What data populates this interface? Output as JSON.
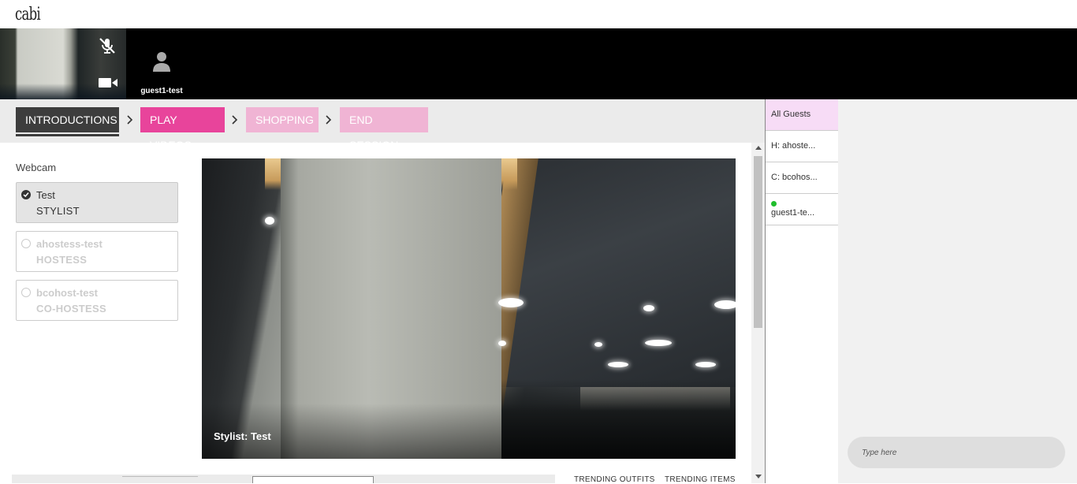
{
  "app": {
    "logo": "cabi"
  },
  "video_strip": {
    "self_tile": {
      "mic_icon": "mic-muted-icon",
      "camera_icon": "video-camera-icon"
    },
    "guest_tile": {
      "name": "guest1-test",
      "icon": "user-avatar-icon"
    }
  },
  "steps": [
    {
      "label": "INTRODUCTIONS",
      "state": "active"
    },
    {
      "label": "PLAY VIDEOS",
      "state": "next"
    },
    {
      "label": "SHOPPING",
      "state": "disabled"
    },
    {
      "label": "END SESSION",
      "state": "disabled"
    }
  ],
  "webcam": {
    "label": "Webcam",
    "participants": [
      {
        "name": "Test",
        "role": "STYLIST",
        "selected": true
      },
      {
        "name": "ahostess-test",
        "role": "HOSTESS",
        "selected": false
      },
      {
        "name": "bcohost-test",
        "role": "CO-HOSTESS",
        "selected": false
      }
    ]
  },
  "stage": {
    "caption": "Stylist: Test"
  },
  "trending": {
    "outfits": "TRENDING OUTFITS",
    "items": "TRENDING ITEMS"
  },
  "guest_list": [
    {
      "label": "All Guests",
      "selected": true
    },
    {
      "label": "H: ahoste..."
    },
    {
      "label": "C: bcohos..."
    },
    {
      "label": "guest1-te...",
      "online": true
    }
  ],
  "chat": {
    "placeholder": "Type here"
  },
  "colors": {
    "brand_pink": "#e8449b",
    "disabled_pink": "#f0b4d4",
    "active_step": "#3d3d3d",
    "online_dot": "#1fbe2c",
    "selected_guest_bg": "#f7dcf6"
  }
}
